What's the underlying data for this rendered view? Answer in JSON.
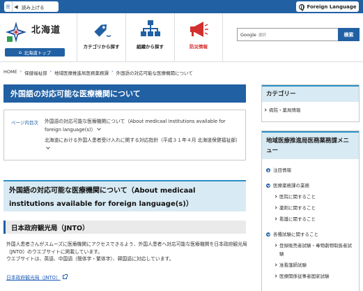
{
  "topbar": {
    "listen_label": "読み上げる",
    "language_label": "Foreign Language"
  },
  "header": {
    "logo_text": "北海道",
    "logo_home_label": "北海道トップ",
    "nav": [
      {
        "label": "カテゴリから探す",
        "icon": "tag-icon"
      },
      {
        "label": "組織から探す",
        "icon": "org-chart-icon"
      },
      {
        "label": "防災情報",
        "icon": "megaphone-icon"
      }
    ],
    "search": {
      "prefix": "Google",
      "placeholder": "選択",
      "button_label": "検索"
    }
  },
  "breadcrumb": [
    "HOME",
    "保健福祉部",
    "地域医療推進局医務薬務課",
    "外国語の対応可能な医療機関について"
  ],
  "main": {
    "title": "外国語の対応可能な医療機関について",
    "toc_label": "ページ内目次",
    "toc_items": [
      "外国語の対応可能な医療機関について（About medicaal institutions available for foreign language(s)）",
      "北海道における外国人患者受け入れに関する対応指針（平成３１年４月 北海道保健福祉部）"
    ],
    "section_title": "外国語の対応可能な医療機関について（About medicaal institutions available for foreign language(s)）",
    "subsection_title": "日本政府観光局（JNTO）",
    "body_lines": [
      "外国人患者さんがスムーズに医療機関にアクセスできるよう、外国人患者へ対応可能な医療機関を日本政府観光局（JNTO）のウエブサイトに掲載しています。",
      "ウエブサイトは、英語、中国語（簡体字・繁体字）、韓国語に対応しています。"
    ],
    "link_label": "日本政府観光局（JNTO）"
  },
  "sidebar": {
    "category_title": "カテゴリー",
    "category_items": [
      "病院・薬局情報"
    ],
    "menu_title": "地域医療推進局医務薬務課メニュー",
    "menu_items": [
      {
        "label": "注目情報",
        "kind": "circle"
      },
      {
        "label": "医療薬務課の業務",
        "kind": "circle-down"
      },
      {
        "label": "医院に関すること",
        "kind": "sub"
      },
      {
        "label": "薬剤に関すること",
        "kind": "sub"
      },
      {
        "label": "看護に関すること",
        "kind": "sub"
      },
      {
        "label": "各種試験に関すること",
        "kind": "circle-down"
      },
      {
        "label": "登録販売者試験・毒物劇物取扱者試験",
        "kind": "sub"
      },
      {
        "label": "准看護師試験",
        "kind": "sub"
      },
      {
        "label": "医療関係従事者国家試験",
        "kind": "sub"
      }
    ]
  },
  "colors": {
    "primary": "#2160a3",
    "accent_light": "#d8eaf3",
    "accent_border": "#2a8fc6",
    "alert_red": "#d32f2f"
  }
}
